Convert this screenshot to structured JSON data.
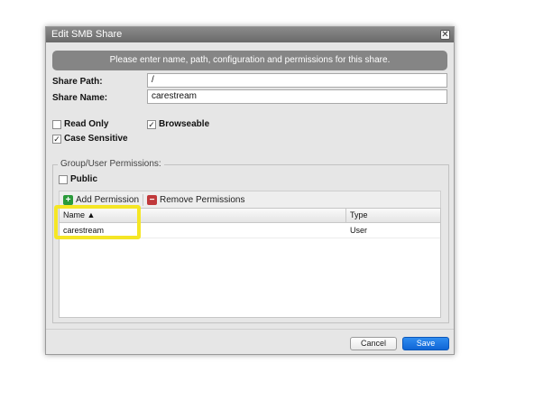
{
  "dialog": {
    "title": "Edit SMB Share",
    "close_glyph": "✕",
    "banner": "Please enter name, path, configuration and permissions for this share."
  },
  "form": {
    "share_path_label": "Share Path:",
    "share_path_value": "/",
    "share_name_label": "Share Name:",
    "share_name_value": "carestream"
  },
  "options": {
    "read_only": {
      "label": "Read Only",
      "checked": false
    },
    "browseable": {
      "label": "Browseable",
      "checked": true
    },
    "case_sensitive": {
      "label": "Case Sensitive",
      "checked": true
    }
  },
  "permissions": {
    "legend": "Group/User Permissions:",
    "public": {
      "label": "Public",
      "checked": false
    },
    "add_button": "Add Permission",
    "remove_button": "Remove Permissions",
    "add_icon": "+",
    "remove_icon": "−",
    "columns": {
      "name": "Name ▲",
      "type": "Type"
    },
    "rows": [
      {
        "name": "carestream",
        "type": "User"
      }
    ]
  },
  "footer": {
    "cancel_label": "Cancel",
    "save_label": "Save"
  },
  "colors": {
    "add_icon": "#2a9a3a",
    "remove_icon": "#c0393b",
    "save_button": "#1a78e6",
    "highlight": "#f5e625"
  },
  "icons": {
    "close": "close-icon",
    "add": "plus-icon",
    "remove": "minus-icon",
    "sort": "sort-ascending-icon",
    "check": "checkmark-icon"
  }
}
